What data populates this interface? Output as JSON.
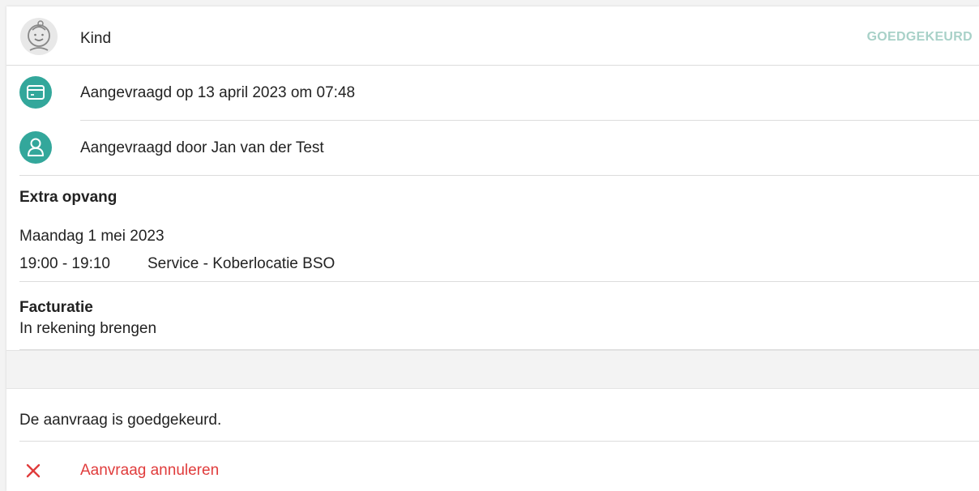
{
  "header": {
    "child_label": "Kind",
    "status": "GOEDGEKEURD",
    "status_color": "#a8d1c8",
    "avatar_icon": "child-face-icon"
  },
  "details": {
    "requested_on": "Aangevraagd op 13 april 2023 om 07:48",
    "requested_on_icon": "credit-card-icon",
    "requested_by": "Aangevraagd door Jan van der Test",
    "requested_by_icon": "person-icon",
    "icon_color": "#33a79b"
  },
  "extra": {
    "heading": "Extra opvang",
    "date": "Maandag 1 mei 2023",
    "time": "19:00 - 19:10",
    "service": "Service - Koberlocatie BSO"
  },
  "billing": {
    "heading": "Facturatie",
    "value": "In rekening brengen"
  },
  "message": "De aanvraag is goedgekeurd.",
  "cancel": {
    "label": "Aanvraag annuleren",
    "icon": "close-icon",
    "color": "#e03c3c"
  }
}
